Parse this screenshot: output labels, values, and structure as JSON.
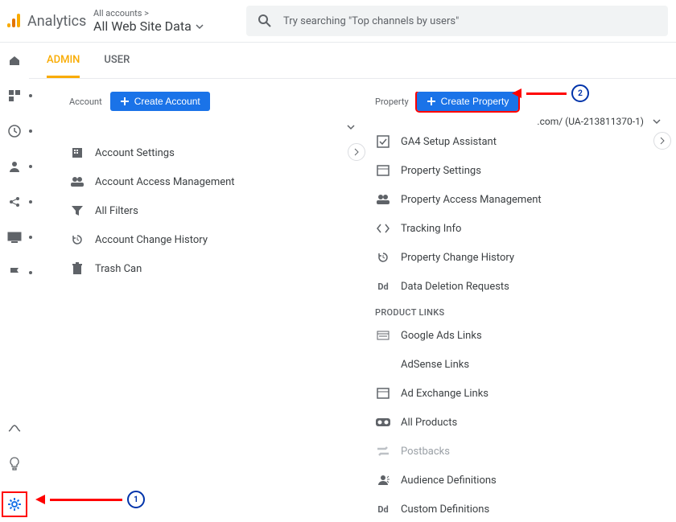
{
  "header": {
    "app_name": "Analytics",
    "breadcrumb_top": "All accounts >",
    "view_name": "All Web Site Data",
    "search_placeholder": "Try searching \"Top channels by users\""
  },
  "tabs": {
    "admin": "ADMIN",
    "user": "USER"
  },
  "account": {
    "label": "Account",
    "create_btn": "Create Account",
    "dropdown": "",
    "items": [
      {
        "icon": "building-icon",
        "label": "Account Settings"
      },
      {
        "icon": "people-icon",
        "label": "Account Access Management"
      },
      {
        "icon": "filter-icon",
        "label": "All Filters"
      },
      {
        "icon": "history-icon",
        "label": "Account Change History"
      },
      {
        "icon": "trash-icon",
        "label": "Trash Can"
      }
    ]
  },
  "property": {
    "label": "Property",
    "create_btn": "Create Property",
    "dropdown": ".com/ (UA-213811370-1)",
    "items": [
      {
        "icon": "checkbox-icon",
        "label": "GA4 Setup Assistant"
      },
      {
        "icon": "panel-icon",
        "label": "Property Settings"
      },
      {
        "icon": "people-icon",
        "label": "Property Access Management"
      },
      {
        "icon": "code-icon",
        "label": "Tracking Info"
      },
      {
        "icon": "history-icon",
        "label": "Property Change History"
      },
      {
        "icon": "dd-icon",
        "label": "Data Deletion Requests"
      }
    ],
    "section_title": "PRODUCT LINKS",
    "links": [
      {
        "icon": "ads-icon",
        "label": "Google Ads Links"
      },
      {
        "icon": "blank-icon",
        "label": "AdSense Links"
      },
      {
        "icon": "panel-icon",
        "label": "Ad Exchange Links"
      },
      {
        "icon": "infinity-icon",
        "label": "All Products"
      },
      {
        "icon": "postbacks-icon",
        "label": "Postbacks"
      },
      {
        "icon": "audience-icon",
        "label": "Audience Definitions"
      },
      {
        "icon": "dd-icon",
        "label": "Custom Definitions"
      }
    ]
  },
  "annotations": {
    "one": "1",
    "two": "2"
  }
}
